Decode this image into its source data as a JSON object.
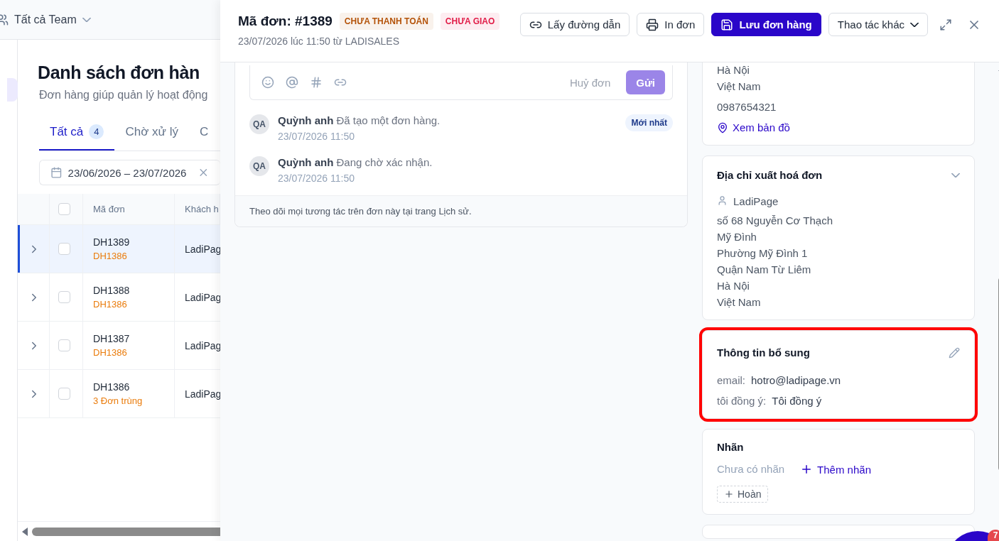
{
  "background_page": {
    "team_selector": "Tất cả Team",
    "title": "Danh sách đơn hàn",
    "subtitle": "Đơn hàng giúp quản lý hoạt động",
    "tabs": [
      {
        "label": "Tất cả",
        "count": "4",
        "selected": true
      },
      {
        "label": "Chờ xử lý",
        "selected": false
      },
      {
        "label": "C",
        "selected": false
      }
    ],
    "date_filter": "23/06/2026 – 23/07/2026",
    "table": {
      "columns": [
        "Mã đơn",
        "Khách h"
      ],
      "select_all_checked": false,
      "rows": [
        {
          "code": "DH1389",
          "note": "DH1386",
          "customer": "LadiPag",
          "selected": true,
          "checked": false
        },
        {
          "code": "DH1388",
          "note": "DH1386",
          "customer": "LadiPag",
          "selected": false,
          "checked": false
        },
        {
          "code": "DH1387",
          "note": "DH1386",
          "customer": "LadiPag",
          "selected": false,
          "checked": false
        },
        {
          "code": "DH1386",
          "note": "3 Đơn trùng",
          "customer": "LadiPag",
          "selected": false,
          "checked": false
        }
      ]
    }
  },
  "drawer": {
    "title": "Mã đơn: #1389",
    "badges": [
      {
        "label": "CHƯA THANH TOÁN",
        "color": "#b45309"
      },
      {
        "label": "CHƯA GIAO",
        "color": "#e11d48"
      }
    ],
    "subtitle": "23/07/2026 lúc 11:50 từ LADISALES",
    "actions": [
      {
        "label": "Lấy đường dẫn",
        "kind": "link"
      },
      {
        "label": "In đơn",
        "kind": "print"
      },
      {
        "label": "Lưu đơn hàng",
        "kind": "save"
      },
      {
        "label": "Thao tác khác",
        "kind": "menu"
      }
    ],
    "activity": {
      "cancel": "Huỷ đơn",
      "send": "Gửi",
      "send_disabled": true,
      "items": [
        {
          "avatar": "QA",
          "author": "Quỳnh anh",
          "text": "Đã tạo một đơn hàng.",
          "time": "23/07/2026 11:50",
          "badge": "Mới nhất"
        },
        {
          "avatar": "QA",
          "author": "Quỳnh anh",
          "text": "Đang chờ xác nhận.",
          "time": "23/07/2026 11:50"
        }
      ],
      "footer": "Theo dõi mọi tương tác trên đơn này tại trang Lịch sử."
    },
    "shipping": {
      "lines": [
        "Hà Nội",
        "Việt Nam"
      ],
      "phone": "0987654321",
      "map_link": "Xem bản đồ"
    },
    "billing": {
      "title": "Địa chỉ xuất hoá đơn",
      "expanded": true,
      "name": "LadiPage",
      "lines": [
        "số 68 Nguyễn Cơ Thạch",
        "Mỹ Đình",
        "Phường Mỹ Đình 1",
        "Quận Nam Từ Liêm",
        "Hà Nội",
        "Việt Nam"
      ]
    },
    "extra_info": {
      "title": "Thông tin bổ sung",
      "highlighted": true,
      "fields": [
        {
          "label": "email:",
          "value": "hotro@ladipage.vn"
        },
        {
          "label": "tôi đồng ý:",
          "value": "Tôi đồng ý"
        }
      ]
    },
    "tags": {
      "title": "Nhãn",
      "empty": "Chưa có nhãn",
      "add": "Thêm nhãn",
      "suggestions": [
        "Hoàn"
      ]
    },
    "chat_badge": "7"
  }
}
